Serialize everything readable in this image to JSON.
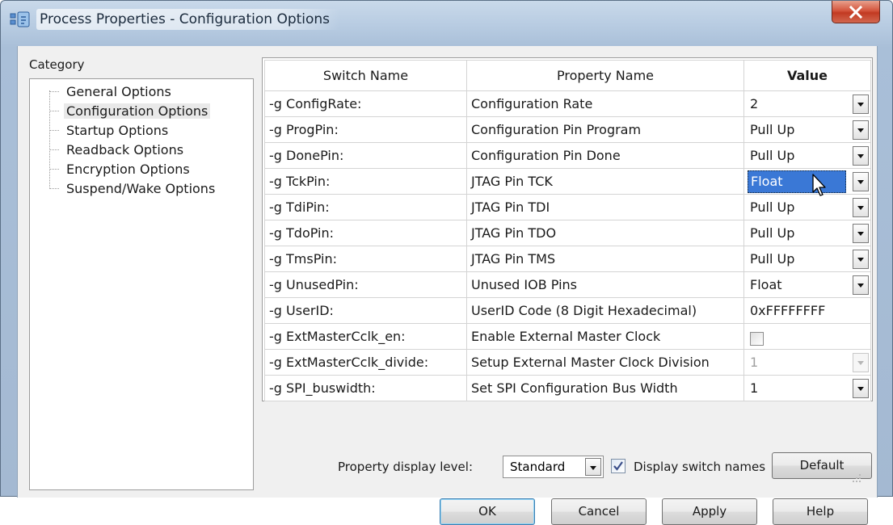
{
  "window": {
    "title": "Process Properties - Configuration Options"
  },
  "category": {
    "label": "Category",
    "items": [
      {
        "label": "General Options",
        "selected": false
      },
      {
        "label": "Configuration Options",
        "selected": true
      },
      {
        "label": "Startup Options",
        "selected": false
      },
      {
        "label": "Readback Options",
        "selected": false
      },
      {
        "label": "Encryption Options",
        "selected": false
      },
      {
        "label": "Suspend/Wake Options",
        "selected": false
      }
    ]
  },
  "grid": {
    "headers": {
      "switch": "Switch Name",
      "property": "Property Name",
      "value": "Value"
    },
    "rows": [
      {
        "switch": "-g ConfigRate:",
        "property": "Configuration Rate",
        "value": "2"
      },
      {
        "switch": "-g ProgPin:",
        "property": "Configuration Pin Program",
        "value": "Pull Up"
      },
      {
        "switch": "-g DonePin:",
        "property": "Configuration Pin Done",
        "value": "Pull Up"
      },
      {
        "switch": "-g TckPin:",
        "property": "JTAG Pin TCK",
        "value": "Float"
      },
      {
        "switch": "-g TdiPin:",
        "property": "JTAG Pin TDI",
        "value": "Pull Up"
      },
      {
        "switch": "-g TdoPin:",
        "property": "JTAG Pin TDO",
        "value": "Pull Up"
      },
      {
        "switch": "-g TmsPin:",
        "property": "JTAG Pin TMS",
        "value": "Pull Up"
      },
      {
        "switch": "-g UnusedPin:",
        "property": "Unused IOB Pins",
        "value": "Float"
      },
      {
        "switch": "-g UserID:",
        "property": "UserID Code (8 Digit Hexadecimal)",
        "value": "0xFFFFFFFF"
      },
      {
        "switch": "-g ExtMasterCclk_en:",
        "property": "Enable External Master Clock",
        "value": ""
      },
      {
        "switch": "-g ExtMasterCclk_divide:",
        "property": "Setup External Master Clock Division",
        "value": "1"
      },
      {
        "switch": "-g SPI_buswidth:",
        "property": "Set SPI Configuration Bus Width",
        "value": "1"
      }
    ]
  },
  "footer": {
    "display_level_label": "Property display level:",
    "display_level_value": "Standard",
    "display_switch_names_label": "Display switch names",
    "display_switch_names_checked": true,
    "default_button": "Default"
  },
  "buttons": {
    "ok": "OK",
    "cancel": "Cancel",
    "apply": "Apply",
    "help": "Help"
  }
}
